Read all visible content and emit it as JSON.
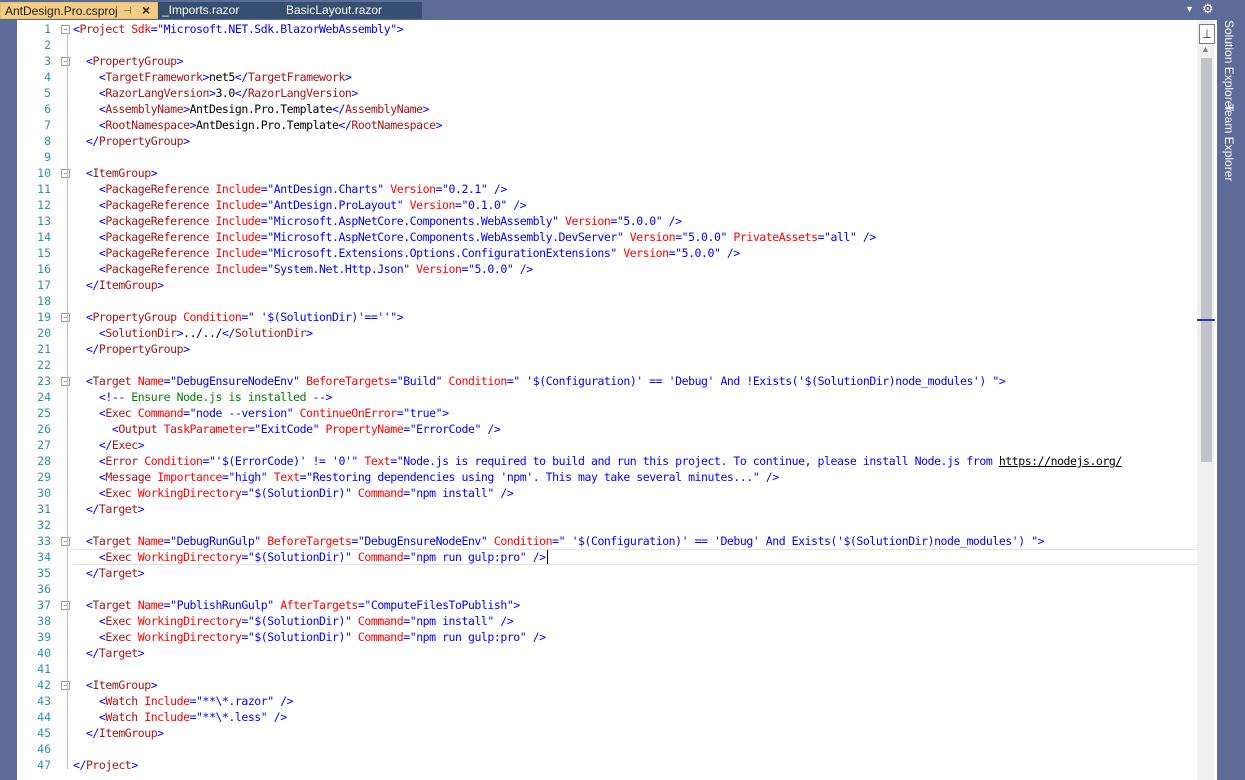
{
  "tabs": [
    {
      "label": "AntDesign.Pro.csproj",
      "active": true,
      "pin_icon": "pin-icon",
      "close_icon": "close-icon"
    },
    {
      "label": "_Imports.razor",
      "active": false
    },
    {
      "label": "BasicLayout.razor",
      "active": false
    }
  ],
  "right_dock": {
    "solution_explorer": "Solution Explorer",
    "team_explorer": "Team Explorer"
  },
  "colors": {
    "chrome": "#5d6b99",
    "active_tab": "#f5cc84",
    "xml_tag": "#a31515",
    "xml_attr": "#ff0000",
    "xml_value": "#0000ff",
    "comment": "#008000",
    "line_number": "#2b91af"
  },
  "editor": {
    "current_line": 34,
    "lines": [
      [
        [
          "b",
          "<"
        ],
        [
          "t",
          "Project"
        ],
        [
          "a",
          " Sdk"
        ],
        [
          "b",
          "=\""
        ],
        [
          "v",
          "Microsoft.NET.Sdk.BlazorWebAssembly"
        ],
        [
          "b",
          "\">"
        ]
      ],
      [],
      [
        [
          "x",
          "  "
        ],
        [
          "b",
          "<"
        ],
        [
          "t",
          "PropertyGroup"
        ],
        [
          "b",
          ">"
        ]
      ],
      [
        [
          "x",
          "    "
        ],
        [
          "b",
          "<"
        ],
        [
          "t",
          "TargetFramework"
        ],
        [
          "b",
          ">"
        ],
        [
          "x",
          "net5"
        ],
        [
          "b",
          "</"
        ],
        [
          "t",
          "TargetFramework"
        ],
        [
          "b",
          ">"
        ]
      ],
      [
        [
          "x",
          "    "
        ],
        [
          "b",
          "<"
        ],
        [
          "t",
          "RazorLangVersion"
        ],
        [
          "b",
          ">"
        ],
        [
          "x",
          "3.0"
        ],
        [
          "b",
          "</"
        ],
        [
          "t",
          "RazorLangVersion"
        ],
        [
          "b",
          ">"
        ]
      ],
      [
        [
          "x",
          "    "
        ],
        [
          "b",
          "<"
        ],
        [
          "t",
          "AssemblyName"
        ],
        [
          "b",
          ">"
        ],
        [
          "x",
          "AntDesign.Pro.Template"
        ],
        [
          "b",
          "</"
        ],
        [
          "t",
          "AssemblyName"
        ],
        [
          "b",
          ">"
        ]
      ],
      [
        [
          "x",
          "    "
        ],
        [
          "b",
          "<"
        ],
        [
          "t",
          "RootNamespace"
        ],
        [
          "b",
          ">"
        ],
        [
          "x",
          "AntDesign.Pro.Template"
        ],
        [
          "b",
          "</"
        ],
        [
          "t",
          "RootNamespace"
        ],
        [
          "b",
          ">"
        ]
      ],
      [
        [
          "x",
          "  "
        ],
        [
          "b",
          "</"
        ],
        [
          "t",
          "PropertyGroup"
        ],
        [
          "b",
          ">"
        ]
      ],
      [],
      [
        [
          "x",
          "  "
        ],
        [
          "b",
          "<"
        ],
        [
          "t",
          "ItemGroup"
        ],
        [
          "b",
          ">"
        ]
      ],
      [
        [
          "x",
          "    "
        ],
        [
          "b",
          "<"
        ],
        [
          "t",
          "PackageReference"
        ],
        [
          "a",
          " Include"
        ],
        [
          "b",
          "=\""
        ],
        [
          "v",
          "AntDesign.Charts"
        ],
        [
          "b",
          "\""
        ],
        [
          "a",
          " Version"
        ],
        [
          "b",
          "=\""
        ],
        [
          "v",
          "0.2.1"
        ],
        [
          "b",
          "\" />"
        ]
      ],
      [
        [
          "x",
          "    "
        ],
        [
          "b",
          "<"
        ],
        [
          "t",
          "PackageReference"
        ],
        [
          "a",
          " Include"
        ],
        [
          "b",
          "=\""
        ],
        [
          "v",
          "AntDesign.ProLayout"
        ],
        [
          "b",
          "\""
        ],
        [
          "a",
          " Version"
        ],
        [
          "b",
          "=\""
        ],
        [
          "v",
          "0.1.0"
        ],
        [
          "b",
          "\" />"
        ]
      ],
      [
        [
          "x",
          "    "
        ],
        [
          "b",
          "<"
        ],
        [
          "t",
          "PackageReference"
        ],
        [
          "a",
          " Include"
        ],
        [
          "b",
          "=\""
        ],
        [
          "v",
          "Microsoft.AspNetCore.Components.WebAssembly"
        ],
        [
          "b",
          "\""
        ],
        [
          "a",
          " Version"
        ],
        [
          "b",
          "=\""
        ],
        [
          "v",
          "5.0.0"
        ],
        [
          "b",
          "\" />"
        ]
      ],
      [
        [
          "x",
          "    "
        ],
        [
          "b",
          "<"
        ],
        [
          "t",
          "PackageReference"
        ],
        [
          "a",
          " Include"
        ],
        [
          "b",
          "=\""
        ],
        [
          "v",
          "Microsoft.AspNetCore.Components.WebAssembly.DevServer"
        ],
        [
          "b",
          "\""
        ],
        [
          "a",
          " Version"
        ],
        [
          "b",
          "=\""
        ],
        [
          "v",
          "5.0.0"
        ],
        [
          "b",
          "\""
        ],
        [
          "a",
          " PrivateAssets"
        ],
        [
          "b",
          "=\""
        ],
        [
          "v",
          "all"
        ],
        [
          "b",
          "\" />"
        ]
      ],
      [
        [
          "x",
          "    "
        ],
        [
          "b",
          "<"
        ],
        [
          "t",
          "PackageReference"
        ],
        [
          "a",
          " Include"
        ],
        [
          "b",
          "=\""
        ],
        [
          "v",
          "Microsoft.Extensions.Options.ConfigurationExtensions"
        ],
        [
          "b",
          "\""
        ],
        [
          "a",
          " Version"
        ],
        [
          "b",
          "=\""
        ],
        [
          "v",
          "5.0.0"
        ],
        [
          "b",
          "\" />"
        ]
      ],
      [
        [
          "x",
          "    "
        ],
        [
          "b",
          "<"
        ],
        [
          "t",
          "PackageReference"
        ],
        [
          "a",
          " Include"
        ],
        [
          "b",
          "=\""
        ],
        [
          "v",
          "System.Net.Http.Json"
        ],
        [
          "b",
          "\""
        ],
        [
          "a",
          " Version"
        ],
        [
          "b",
          "=\""
        ],
        [
          "v",
          "5.0.0"
        ],
        [
          "b",
          "\" />"
        ]
      ],
      [
        [
          "x",
          "  "
        ],
        [
          "b",
          "</"
        ],
        [
          "t",
          "ItemGroup"
        ],
        [
          "b",
          ">"
        ]
      ],
      [],
      [
        [
          "x",
          "  "
        ],
        [
          "b",
          "<"
        ],
        [
          "t",
          "PropertyGroup"
        ],
        [
          "a",
          " Condition"
        ],
        [
          "b",
          "=\""
        ],
        [
          "v",
          " '$(SolutionDir)'==''"
        ],
        [
          "b",
          "\">"
        ]
      ],
      [
        [
          "x",
          "    "
        ],
        [
          "b",
          "<"
        ],
        [
          "t",
          "SolutionDir"
        ],
        [
          "b",
          ">"
        ],
        [
          "x",
          "../../"
        ],
        [
          "b",
          "</"
        ],
        [
          "t",
          "SolutionDir"
        ],
        [
          "b",
          ">"
        ]
      ],
      [
        [
          "x",
          "  "
        ],
        [
          "b",
          "</"
        ],
        [
          "t",
          "PropertyGroup"
        ],
        [
          "b",
          ">"
        ]
      ],
      [],
      [
        [
          "x",
          "  "
        ],
        [
          "b",
          "<"
        ],
        [
          "t",
          "Target"
        ],
        [
          "a",
          " Name"
        ],
        [
          "b",
          "=\""
        ],
        [
          "v",
          "DebugEnsureNodeEnv"
        ],
        [
          "b",
          "\""
        ],
        [
          "a",
          " BeforeTargets"
        ],
        [
          "b",
          "=\""
        ],
        [
          "v",
          "Build"
        ],
        [
          "b",
          "\""
        ],
        [
          "a",
          " Condition"
        ],
        [
          "b",
          "=\""
        ],
        [
          "v",
          " '$(Configuration)' == 'Debug' And !Exists('$(SolutionDir)node_modules') "
        ],
        [
          "b",
          "\">"
        ]
      ],
      [
        [
          "x",
          "    "
        ],
        [
          "b",
          "<!--"
        ],
        [
          "c",
          " Ensure Node.js is installed "
        ],
        [
          "b",
          "-->"
        ]
      ],
      [
        [
          "x",
          "    "
        ],
        [
          "b",
          "<"
        ],
        [
          "t",
          "Exec"
        ],
        [
          "a",
          " Command"
        ],
        [
          "b",
          "=\""
        ],
        [
          "v",
          "node --version"
        ],
        [
          "b",
          "\""
        ],
        [
          "a",
          " ContinueOnError"
        ],
        [
          "b",
          "=\""
        ],
        [
          "v",
          "true"
        ],
        [
          "b",
          "\">"
        ]
      ],
      [
        [
          "x",
          "      "
        ],
        [
          "b",
          "<"
        ],
        [
          "t",
          "Output"
        ],
        [
          "a",
          " TaskParameter"
        ],
        [
          "b",
          "=\""
        ],
        [
          "v",
          "ExitCode"
        ],
        [
          "b",
          "\""
        ],
        [
          "a",
          " PropertyName"
        ],
        [
          "b",
          "=\""
        ],
        [
          "v",
          "ErrorCode"
        ],
        [
          "b",
          "\" />"
        ]
      ],
      [
        [
          "x",
          "    "
        ],
        [
          "b",
          "</"
        ],
        [
          "t",
          "Exec"
        ],
        [
          "b",
          ">"
        ]
      ],
      [
        [
          "x",
          "    "
        ],
        [
          "b",
          "<"
        ],
        [
          "t",
          "Error"
        ],
        [
          "a",
          " Condition"
        ],
        [
          "b",
          "=\""
        ],
        [
          "v",
          "'$(ErrorCode)' != '0'"
        ],
        [
          "b",
          "\""
        ],
        [
          "a",
          " Text"
        ],
        [
          "b",
          "=\""
        ],
        [
          "v",
          "Node.js is required to build and run this project. To continue, please install Node.js from "
        ],
        [
          "l",
          "https://nodejs.org/"
        ]
      ],
      [
        [
          "x",
          "    "
        ],
        [
          "b",
          "<"
        ],
        [
          "t",
          "Message"
        ],
        [
          "a",
          " Importance"
        ],
        [
          "b",
          "=\""
        ],
        [
          "v",
          "high"
        ],
        [
          "b",
          "\""
        ],
        [
          "a",
          " Text"
        ],
        [
          "b",
          "=\""
        ],
        [
          "v",
          "Restoring dependencies using 'npm'. This may take several minutes..."
        ],
        [
          "b",
          "\" />"
        ]
      ],
      [
        [
          "x",
          "    "
        ],
        [
          "b",
          "<"
        ],
        [
          "t",
          "Exec"
        ],
        [
          "a",
          " WorkingDirectory"
        ],
        [
          "b",
          "=\""
        ],
        [
          "v",
          "$(SolutionDir)"
        ],
        [
          "b",
          "\""
        ],
        [
          "a",
          " Command"
        ],
        [
          "b",
          "=\""
        ],
        [
          "v",
          "npm install"
        ],
        [
          "b",
          "\" />"
        ]
      ],
      [
        [
          "x",
          "  "
        ],
        [
          "b",
          "</"
        ],
        [
          "t",
          "Target"
        ],
        [
          "b",
          ">"
        ]
      ],
      [],
      [
        [
          "x",
          "  "
        ],
        [
          "b",
          "<"
        ],
        [
          "t",
          "Target"
        ],
        [
          "a",
          " Name"
        ],
        [
          "b",
          "=\""
        ],
        [
          "v",
          "DebugRunGulp"
        ],
        [
          "b",
          "\""
        ],
        [
          "a",
          " BeforeTargets"
        ],
        [
          "b",
          "=\""
        ],
        [
          "v",
          "DebugEnsureNodeEnv"
        ],
        [
          "b",
          "\""
        ],
        [
          "a",
          " Condition"
        ],
        [
          "b",
          "=\""
        ],
        [
          "v",
          " '$(Configuration)' == 'Debug' And Exists('$(SolutionDir)node_modules') "
        ],
        [
          "b",
          "\">"
        ]
      ],
      [
        [
          "x",
          "    "
        ],
        [
          "b",
          "<"
        ],
        [
          "t",
          "Exec"
        ],
        [
          "a",
          " WorkingDirectory"
        ],
        [
          "b",
          "=\""
        ],
        [
          "v",
          "$(SolutionDir)"
        ],
        [
          "b",
          "\""
        ],
        [
          "a",
          " Command"
        ],
        [
          "b",
          "=\""
        ],
        [
          "v",
          "npm run gulp:pro"
        ],
        [
          "b",
          "\" />"
        ]
      ],
      [
        [
          "x",
          "  "
        ],
        [
          "b",
          "</"
        ],
        [
          "t",
          "Target"
        ],
        [
          "b",
          ">"
        ]
      ],
      [],
      [
        [
          "x",
          "  "
        ],
        [
          "b",
          "<"
        ],
        [
          "t",
          "Target"
        ],
        [
          "a",
          " Name"
        ],
        [
          "b",
          "=\""
        ],
        [
          "v",
          "PublishRunGulp"
        ],
        [
          "b",
          "\""
        ],
        [
          "a",
          " AfterTargets"
        ],
        [
          "b",
          "=\""
        ],
        [
          "v",
          "ComputeFilesToPublish"
        ],
        [
          "b",
          "\">"
        ]
      ],
      [
        [
          "x",
          "    "
        ],
        [
          "b",
          "<"
        ],
        [
          "t",
          "Exec"
        ],
        [
          "a",
          " WorkingDirectory"
        ],
        [
          "b",
          "=\""
        ],
        [
          "v",
          "$(SolutionDir)"
        ],
        [
          "b",
          "\""
        ],
        [
          "a",
          " Command"
        ],
        [
          "b",
          "=\""
        ],
        [
          "v",
          "npm install"
        ],
        [
          "b",
          "\" />"
        ]
      ],
      [
        [
          "x",
          "    "
        ],
        [
          "b",
          "<"
        ],
        [
          "t",
          "Exec"
        ],
        [
          "a",
          " WorkingDirectory"
        ],
        [
          "b",
          "=\""
        ],
        [
          "v",
          "$(SolutionDir)"
        ],
        [
          "b",
          "\""
        ],
        [
          "a",
          " Command"
        ],
        [
          "b",
          "=\""
        ],
        [
          "v",
          "npm run gulp:pro"
        ],
        [
          "b",
          "\" />"
        ]
      ],
      [
        [
          "x",
          "  "
        ],
        [
          "b",
          "</"
        ],
        [
          "t",
          "Target"
        ],
        [
          "b",
          ">"
        ]
      ],
      [],
      [
        [
          "x",
          "  "
        ],
        [
          "b",
          "<"
        ],
        [
          "t",
          "ItemGroup"
        ],
        [
          "b",
          ">"
        ]
      ],
      [
        [
          "x",
          "    "
        ],
        [
          "b",
          "<"
        ],
        [
          "t",
          "Watch"
        ],
        [
          "a",
          " Include"
        ],
        [
          "b",
          "=\""
        ],
        [
          "v",
          "**\\*.razor"
        ],
        [
          "b",
          "\" />"
        ]
      ],
      [
        [
          "x",
          "    "
        ],
        [
          "b",
          "<"
        ],
        [
          "t",
          "Watch"
        ],
        [
          "a",
          " Include"
        ],
        [
          "b",
          "=\""
        ],
        [
          "v",
          "**\\*.less"
        ],
        [
          "b",
          "\" />"
        ]
      ],
      [
        [
          "x",
          "  "
        ],
        [
          "b",
          "</"
        ],
        [
          "t",
          "ItemGroup"
        ],
        [
          "b",
          ">"
        ]
      ],
      [],
      [
        [
          "b",
          "</"
        ],
        [
          "t",
          "Project"
        ],
        [
          "b",
          ">"
        ]
      ]
    ],
    "folds": [
      1,
      3,
      10,
      19,
      23,
      33,
      37,
      42
    ]
  }
}
